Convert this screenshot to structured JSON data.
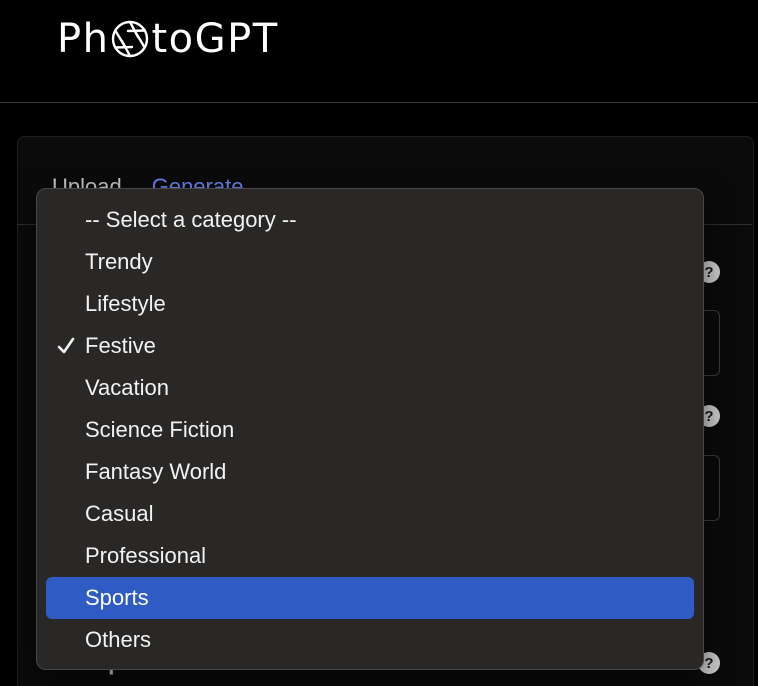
{
  "app": {
    "logo_prefix": "Ph",
    "logo_suffix": "toGPT"
  },
  "tabs": [
    {
      "label": "Upload"
    },
    {
      "label": "Generate"
    }
  ],
  "background": {
    "section_label": "Prompt"
  },
  "dropdown": {
    "options": [
      {
        "label": "-- Select a category --"
      },
      {
        "label": "Trendy"
      },
      {
        "label": "Lifestyle"
      },
      {
        "label": "Festive"
      },
      {
        "label": "Vacation"
      },
      {
        "label": "Science Fiction"
      },
      {
        "label": "Fantasy World"
      },
      {
        "label": "Casual"
      },
      {
        "label": "Professional"
      },
      {
        "label": "Sports"
      },
      {
        "label": "Others"
      }
    ],
    "selected": "Festive",
    "hovered": "Sports"
  },
  "colors": {
    "accent": "#6b84f0",
    "highlight": "#2f5bc4",
    "popup_bg": "#2a2827"
  },
  "icons": {
    "logo_o": "camera-aperture-icon",
    "selected_mark": "checkmark-icon",
    "help": "help-icon"
  }
}
